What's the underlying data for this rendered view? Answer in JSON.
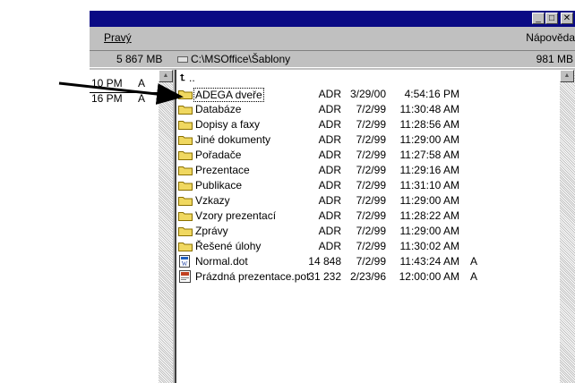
{
  "window": {
    "title_buttons": {
      "minimize": "_",
      "maximize": "□",
      "close": "✕"
    }
  },
  "menubar": {
    "left": "Pravý",
    "right": "Nápověda"
  },
  "drive_bar": {
    "left_free": "5 867 MB",
    "path": "C:\\MSOffice\\Šablony",
    "right_free": "981 MB"
  },
  "left_panel": {
    "rows": [
      {
        "time": "10 PM",
        "attr": "A"
      },
      {
        "time": "16 PM",
        "attr": "A"
      }
    ]
  },
  "file_list": {
    "up_label": "..",
    "items": [
      {
        "name": "ADEGA dveře",
        "type": "ADR",
        "date": "3/29/00",
        "time": "4:54:16 PM",
        "attr": "",
        "icon": "folder-icon"
      },
      {
        "name": "Databáze",
        "type": "ADR",
        "date": "7/2/99",
        "time": "11:30:48 AM",
        "attr": "",
        "icon": "folder-icon"
      },
      {
        "name": "Dopisy a faxy",
        "type": "ADR",
        "date": "7/2/99",
        "time": "11:28:56 AM",
        "attr": "",
        "icon": "folder-icon"
      },
      {
        "name": "Jiné dokumenty",
        "type": "ADR",
        "date": "7/2/99",
        "time": "11:29:00 AM",
        "attr": "",
        "icon": "folder-icon"
      },
      {
        "name": "Pořadače",
        "type": "ADR",
        "date": "7/2/99",
        "time": "11:27:58 AM",
        "attr": "",
        "icon": "folder-icon"
      },
      {
        "name": "Prezentace",
        "type": "ADR",
        "date": "7/2/99",
        "time": "11:29:16 AM",
        "attr": "",
        "icon": "folder-icon"
      },
      {
        "name": "Publikace",
        "type": "ADR",
        "date": "7/2/99",
        "time": "11:31:10 AM",
        "attr": "",
        "icon": "folder-icon"
      },
      {
        "name": "Vzkazy",
        "type": "ADR",
        "date": "7/2/99",
        "time": "11:29:00 AM",
        "attr": "",
        "icon": "folder-icon"
      },
      {
        "name": "Vzory prezentací",
        "type": "ADR",
        "date": "7/2/99",
        "time": "11:28:22 AM",
        "attr": "",
        "icon": "folder-icon"
      },
      {
        "name": "Zprávy",
        "type": "ADR",
        "date": "7/2/99",
        "time": "11:29:00 AM",
        "attr": "",
        "icon": "folder-icon"
      },
      {
        "name": "Řešené úlohy",
        "type": "ADR",
        "date": "7/2/99",
        "time": "11:30:02 AM",
        "attr": "",
        "icon": "folder-icon"
      },
      {
        "name": "Normal.dot",
        "type": "14 848",
        "date": "7/2/99",
        "time": "11:43:24 AM",
        "attr": "A",
        "icon": "word-template-icon"
      },
      {
        "name": "Prázdná prezentace.pot",
        "type": "31 232",
        "date": "2/23/96",
        "time": "12:00:00 AM",
        "attr": "A",
        "icon": "powerpoint-template-icon"
      }
    ]
  },
  "colors": {
    "title_bar": "#0a0a84",
    "face": "#c0c0c0",
    "folder": "#f0d860",
    "folder_edge": "#8a7000"
  }
}
